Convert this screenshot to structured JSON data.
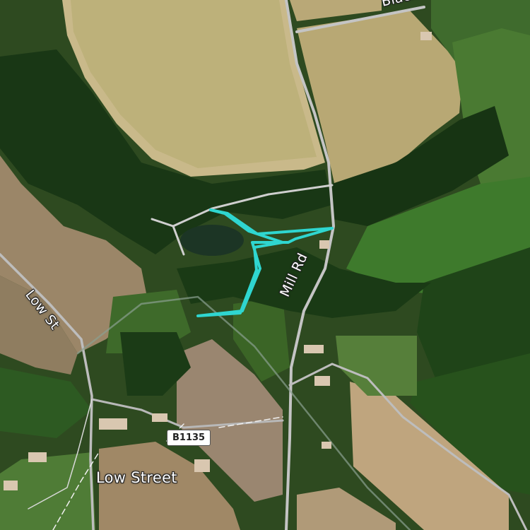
{
  "map": {
    "type": "satellite",
    "labels": {
      "black_road": "Black",
      "mill_rd": "Mill Rd",
      "low_st": "Low St",
      "village": "Low Street"
    },
    "road_shield": "B1135",
    "route_color": "#2fd6d0",
    "road_color": "#b9b9b9"
  }
}
